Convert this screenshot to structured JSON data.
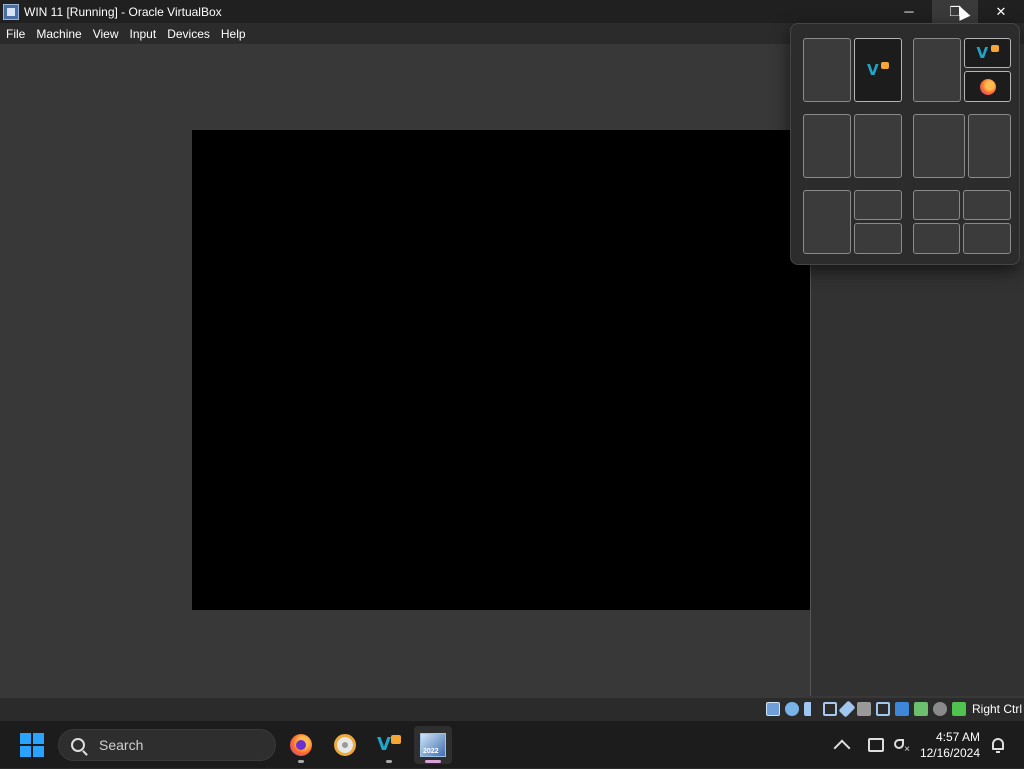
{
  "window": {
    "title": "WIN 11 [Running] - Oracle VirtualBox",
    "controls": {
      "minimize": "─",
      "maximize": "❐",
      "close": "✕"
    }
  },
  "menu": {
    "items": [
      "File",
      "Machine",
      "View",
      "Input",
      "Devices",
      "Help"
    ]
  },
  "statusbar": {
    "host_key": "Right Ctrl",
    "icons": [
      "hard-disk-icon",
      "optical-drive-icon",
      "audio-icon",
      "network-icon",
      "usb-icon",
      "shared-folders-icon",
      "display-icon",
      "video-capture-icon",
      "mouse-integration-icon",
      "cpu-icon",
      "keyboard-icon"
    ]
  },
  "snap_layouts": {
    "layouts": [
      {
        "name": "two-columns",
        "filled": "right"
      },
      {
        "name": "main-and-two-stacked",
        "filled": "right-top-and-bottom"
      },
      {
        "name": "two-columns-equal"
      },
      {
        "name": "wide-and-narrow"
      },
      {
        "name": "one-and-two-stacked"
      },
      {
        "name": "four-grid"
      }
    ]
  },
  "taskbar": {
    "search_placeholder": "Search",
    "apps": [
      "firefox-icon",
      "disc-app-icon",
      "vs-app-icon",
      "virtualbox-icon"
    ],
    "clock_time": "4:57 AM",
    "clock_date": "12/16/2024"
  }
}
